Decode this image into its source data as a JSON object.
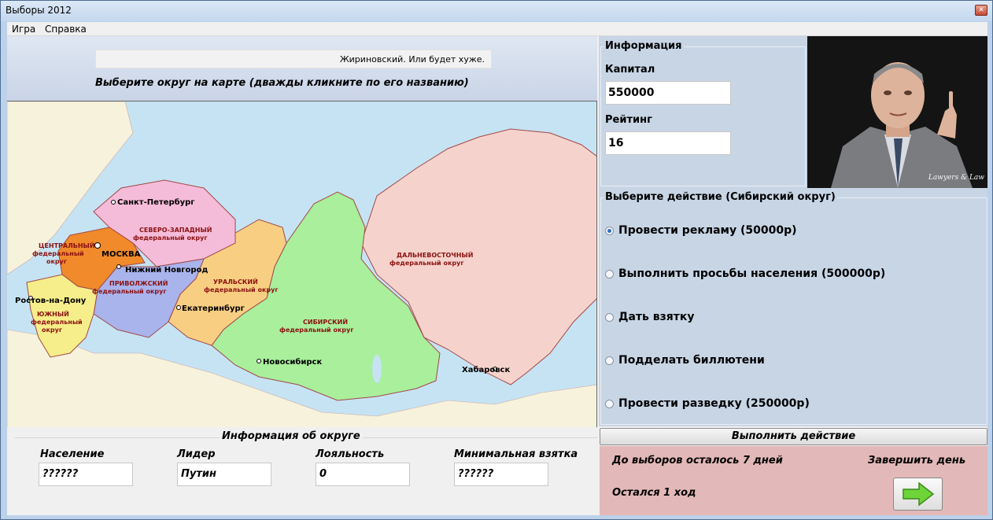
{
  "window": {
    "title": "Выборы 2012",
    "close_label": "✕"
  },
  "menu": {
    "items": [
      "Игра",
      "Справка"
    ]
  },
  "header": {
    "slogan": "Жириновский. Или будет хуже.",
    "map_prompt": "Выберите округ на карте (дважды кликните по его названию)"
  },
  "map": {
    "cities": [
      "Санкт-Петербург",
      "МОСКВА",
      "Нижний Новгород",
      "Ростов-на-Дону",
      "Екатеринбург",
      "Новосибирск",
      "Хабаровск"
    ],
    "regions": {
      "central": [
        "ЦЕНТРАЛЬНЫЙ",
        "федеральный",
        "округ"
      ],
      "northwest": [
        "СЕВЕРО-ЗАПАДНЫЙ",
        "федеральный округ"
      ],
      "volga": [
        "ПРИВОЛЖСКИЙ",
        "федеральный округ"
      ],
      "south": [
        "ЮЖНЫЙ",
        "федеральный",
        "округ"
      ],
      "ural": [
        "УРАЛЬСКИЙ",
        "федеральный округ"
      ],
      "siberia": [
        "СИБИРСКИЙ",
        "федеральный округ"
      ],
      "fareast": [
        "ДАЛЬНЕВОСТОЧНЫЙ",
        "федеральный округ"
      ]
    },
    "colors": {
      "sea": "#c6e3f3",
      "central": "#f08a2a",
      "northwest": "#f5bcd9",
      "volga": "#a9b3ec",
      "south": "#f6ee8a",
      "ural": "#f8cf82",
      "siberia": "#a9ef9c",
      "fareast": "#f6d2cc",
      "foreign": "#f7f2dc"
    }
  },
  "district": {
    "title": "Информация об округе",
    "population_label": "Население",
    "population_value": "??????",
    "leader_label": "Лидер",
    "leader_value": "Путин",
    "loyalty_label": "Лояльность",
    "loyalty_value": "0",
    "bribe_label": "Минимальная взятка",
    "bribe_value": "??????"
  },
  "info": {
    "title": "Информация",
    "capital_label": "Капитал",
    "capital_value": "550000",
    "rating_label": "Рейтинг",
    "rating_value": "16"
  },
  "portrait": {
    "watermark": "Lawyers & Law"
  },
  "actions": {
    "title": "Выберите действие (Сибирский округ)",
    "options": [
      {
        "label": "Провести рекламу (50000р)",
        "checked": true
      },
      {
        "label": "Выполнить просьбы населения (500000р)",
        "checked": false
      },
      {
        "label": "Дать взятку",
        "checked": false
      },
      {
        "label": "Подделать биллютени",
        "checked": false
      },
      {
        "label": "Провести разведку (250000р)",
        "checked": false
      }
    ],
    "execute_label": "Выполнить действие"
  },
  "status": {
    "days_left": "До выборов осталось 7 дней",
    "finish_day": "Завершить день",
    "moves_left": "Остался 1 ход"
  }
}
